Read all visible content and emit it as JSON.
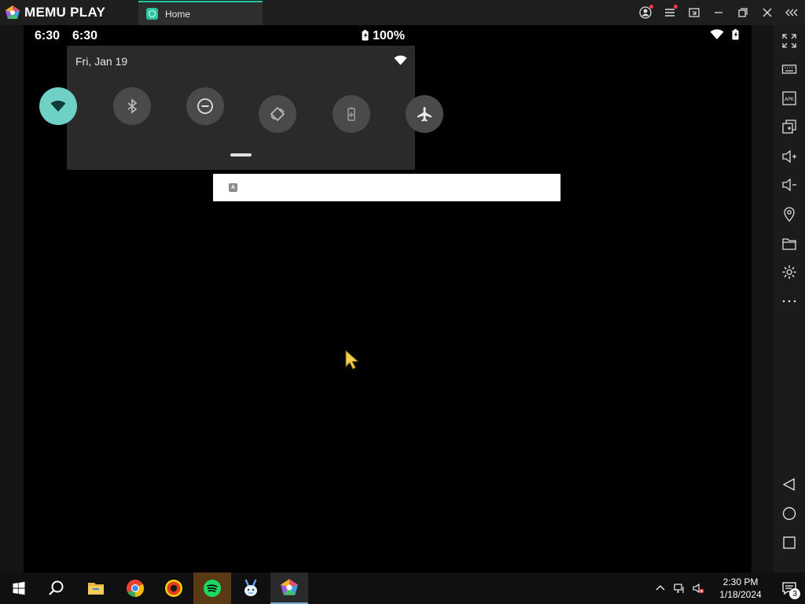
{
  "app": {
    "brand": "MEMU PLAY"
  },
  "tabs": [
    {
      "label": "Home"
    }
  ],
  "android": {
    "status": {
      "time": "6:30",
      "time_secondary": "6:30",
      "battery": "100%"
    },
    "quick_settings": {
      "date": "Fri, Jan 19",
      "tiles": [
        {
          "name": "wifi",
          "active": true
        },
        {
          "name": "bluetooth",
          "active": false
        },
        {
          "name": "do-not-disturb",
          "active": false
        },
        {
          "name": "auto-rotate",
          "active": false
        },
        {
          "name": "battery-saver",
          "active": false
        },
        {
          "name": "airplane-mode",
          "active": false
        }
      ]
    },
    "search_widget": {
      "icon_letter": "A"
    }
  },
  "sidebar_icons": [
    "fullscreen-icon",
    "keyboard-icon",
    "apk-icon",
    "multi-instance-icon",
    "volume-up-icon",
    "volume-down-icon",
    "location-icon",
    "folder-icon",
    "settings-icon",
    "more-icon",
    "back-icon",
    "home-icon",
    "recents-icon"
  ],
  "taskbar": {
    "apps": [
      "windows-start-icon",
      "search-icon",
      "file-explorer-icon",
      "chrome-icon",
      "brave-icon",
      "spotify-icon",
      "bunny-app-icon",
      "memu-icon"
    ],
    "clock_time": "2:30 PM",
    "clock_date": "1/18/2024",
    "notification_count": "3"
  },
  "colors": {
    "accent": "#23c6a4",
    "tile_active": "#6fd1c5",
    "tile_inactive": "#4a4a4a",
    "panel": "#2a2a2a"
  }
}
